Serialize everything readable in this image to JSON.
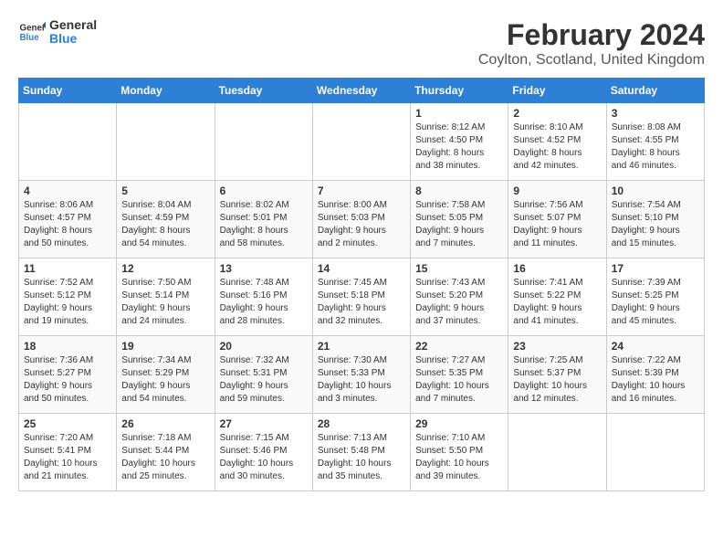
{
  "header": {
    "logo_general": "General",
    "logo_blue": "Blue",
    "title": "February 2024",
    "subtitle": "Coylton, Scotland, United Kingdom"
  },
  "calendar": {
    "days_of_week": [
      "Sunday",
      "Monday",
      "Tuesday",
      "Wednesday",
      "Thursday",
      "Friday",
      "Saturday"
    ],
    "weeks": [
      [
        {
          "day": "",
          "info": ""
        },
        {
          "day": "",
          "info": ""
        },
        {
          "day": "",
          "info": ""
        },
        {
          "day": "",
          "info": ""
        },
        {
          "day": "1",
          "info": "Sunrise: 8:12 AM\nSunset: 4:50 PM\nDaylight: 8 hours\nand 38 minutes."
        },
        {
          "day": "2",
          "info": "Sunrise: 8:10 AM\nSunset: 4:52 PM\nDaylight: 8 hours\nand 42 minutes."
        },
        {
          "day": "3",
          "info": "Sunrise: 8:08 AM\nSunset: 4:55 PM\nDaylight: 8 hours\nand 46 minutes."
        }
      ],
      [
        {
          "day": "4",
          "info": "Sunrise: 8:06 AM\nSunset: 4:57 PM\nDaylight: 8 hours\nand 50 minutes."
        },
        {
          "day": "5",
          "info": "Sunrise: 8:04 AM\nSunset: 4:59 PM\nDaylight: 8 hours\nand 54 minutes."
        },
        {
          "day": "6",
          "info": "Sunrise: 8:02 AM\nSunset: 5:01 PM\nDaylight: 8 hours\nand 58 minutes."
        },
        {
          "day": "7",
          "info": "Sunrise: 8:00 AM\nSunset: 5:03 PM\nDaylight: 9 hours\nand 2 minutes."
        },
        {
          "day": "8",
          "info": "Sunrise: 7:58 AM\nSunset: 5:05 PM\nDaylight: 9 hours\nand 7 minutes."
        },
        {
          "day": "9",
          "info": "Sunrise: 7:56 AM\nSunset: 5:07 PM\nDaylight: 9 hours\nand 11 minutes."
        },
        {
          "day": "10",
          "info": "Sunrise: 7:54 AM\nSunset: 5:10 PM\nDaylight: 9 hours\nand 15 minutes."
        }
      ],
      [
        {
          "day": "11",
          "info": "Sunrise: 7:52 AM\nSunset: 5:12 PM\nDaylight: 9 hours\nand 19 minutes."
        },
        {
          "day": "12",
          "info": "Sunrise: 7:50 AM\nSunset: 5:14 PM\nDaylight: 9 hours\nand 24 minutes."
        },
        {
          "day": "13",
          "info": "Sunrise: 7:48 AM\nSunset: 5:16 PM\nDaylight: 9 hours\nand 28 minutes."
        },
        {
          "day": "14",
          "info": "Sunrise: 7:45 AM\nSunset: 5:18 PM\nDaylight: 9 hours\nand 32 minutes."
        },
        {
          "day": "15",
          "info": "Sunrise: 7:43 AM\nSunset: 5:20 PM\nDaylight: 9 hours\nand 37 minutes."
        },
        {
          "day": "16",
          "info": "Sunrise: 7:41 AM\nSunset: 5:22 PM\nDaylight: 9 hours\nand 41 minutes."
        },
        {
          "day": "17",
          "info": "Sunrise: 7:39 AM\nSunset: 5:25 PM\nDaylight: 9 hours\nand 45 minutes."
        }
      ],
      [
        {
          "day": "18",
          "info": "Sunrise: 7:36 AM\nSunset: 5:27 PM\nDaylight: 9 hours\nand 50 minutes."
        },
        {
          "day": "19",
          "info": "Sunrise: 7:34 AM\nSunset: 5:29 PM\nDaylight: 9 hours\nand 54 minutes."
        },
        {
          "day": "20",
          "info": "Sunrise: 7:32 AM\nSunset: 5:31 PM\nDaylight: 9 hours\nand 59 minutes."
        },
        {
          "day": "21",
          "info": "Sunrise: 7:30 AM\nSunset: 5:33 PM\nDaylight: 10 hours\nand 3 minutes."
        },
        {
          "day": "22",
          "info": "Sunrise: 7:27 AM\nSunset: 5:35 PM\nDaylight: 10 hours\nand 7 minutes."
        },
        {
          "day": "23",
          "info": "Sunrise: 7:25 AM\nSunset: 5:37 PM\nDaylight: 10 hours\nand 12 minutes."
        },
        {
          "day": "24",
          "info": "Sunrise: 7:22 AM\nSunset: 5:39 PM\nDaylight: 10 hours\nand 16 minutes."
        }
      ],
      [
        {
          "day": "25",
          "info": "Sunrise: 7:20 AM\nSunset: 5:41 PM\nDaylight: 10 hours\nand 21 minutes."
        },
        {
          "day": "26",
          "info": "Sunrise: 7:18 AM\nSunset: 5:44 PM\nDaylight: 10 hours\nand 25 minutes."
        },
        {
          "day": "27",
          "info": "Sunrise: 7:15 AM\nSunset: 5:46 PM\nDaylight: 10 hours\nand 30 minutes."
        },
        {
          "day": "28",
          "info": "Sunrise: 7:13 AM\nSunset: 5:48 PM\nDaylight: 10 hours\nand 35 minutes."
        },
        {
          "day": "29",
          "info": "Sunrise: 7:10 AM\nSunset: 5:50 PM\nDaylight: 10 hours\nand 39 minutes."
        },
        {
          "day": "",
          "info": ""
        },
        {
          "day": "",
          "info": ""
        }
      ]
    ]
  }
}
